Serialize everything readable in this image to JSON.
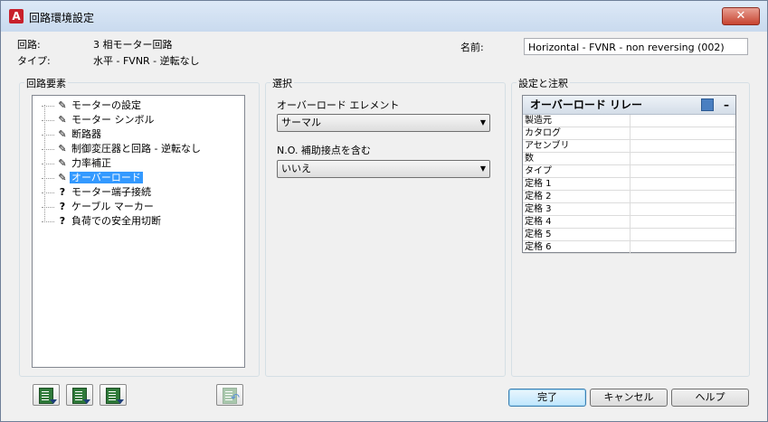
{
  "window": {
    "title": "回路環境設定"
  },
  "info": {
    "circuit_label": "回路:",
    "circuit_value": "3 相モーター回路",
    "type_label": "タイプ:",
    "type_value": "水平 - FVNR - 逆転なし",
    "name_label": "名前:",
    "name_value": "Horizontal - FVNR - non reversing (002)"
  },
  "left_panel": {
    "title": "回路要素",
    "tree_items": [
      {
        "icon": "pencil-icon",
        "label": "モーターの設定",
        "selected": false
      },
      {
        "icon": "pencil-icon",
        "label": "モーター シンボル",
        "selected": false
      },
      {
        "icon": "pencil-icon",
        "label": "断路器",
        "selected": false
      },
      {
        "icon": "pencil-icon",
        "label": "制御変圧器と回路 - 逆転なし",
        "selected": false
      },
      {
        "icon": "pencil-icon",
        "label": "力率補正",
        "selected": false
      },
      {
        "icon": "pencil-icon",
        "label": "オーバーロード",
        "selected": true
      },
      {
        "icon": "question-icon",
        "label": "モーター端子接続",
        "selected": false
      },
      {
        "icon": "question-icon",
        "label": "ケーブル マーカー",
        "selected": false
      },
      {
        "icon": "question-icon",
        "label": "負荷での安全用切断",
        "selected": false
      }
    ]
  },
  "middle_panel": {
    "title": "選択",
    "element_label": "オーバーロード エレメント",
    "element_value": "サーマル",
    "aux_label": "N.O. 補助接点を含む",
    "aux_value": "いいえ"
  },
  "right_panel": {
    "title": "設定と注釈",
    "grid_title": "オーバーロード リレー",
    "collapse_glyph": "–",
    "rows": [
      {
        "label": "製造元",
        "value": ""
      },
      {
        "label": "カタログ",
        "value": ""
      },
      {
        "label": "アセンブリ",
        "value": ""
      },
      {
        "label": "数",
        "value": ""
      },
      {
        "label": "タイプ",
        "value": ""
      },
      {
        "label": "定格 1",
        "value": ""
      },
      {
        "label": "定格 2",
        "value": ""
      },
      {
        "label": "定格 3",
        "value": ""
      },
      {
        "label": "定格 4",
        "value": ""
      },
      {
        "label": "定格 5",
        "value": ""
      },
      {
        "label": "定格 6",
        "value": ""
      }
    ]
  },
  "buttons": {
    "ok": "完了",
    "cancel": "キャンセル",
    "help": "ヘルプ"
  },
  "colors": {
    "selection": "#3399ff",
    "title_bar": "#c9daee",
    "close_button": "#c7432f",
    "app_icon": "#c8202b",
    "toolbar_icon": "#2f7a3a"
  }
}
